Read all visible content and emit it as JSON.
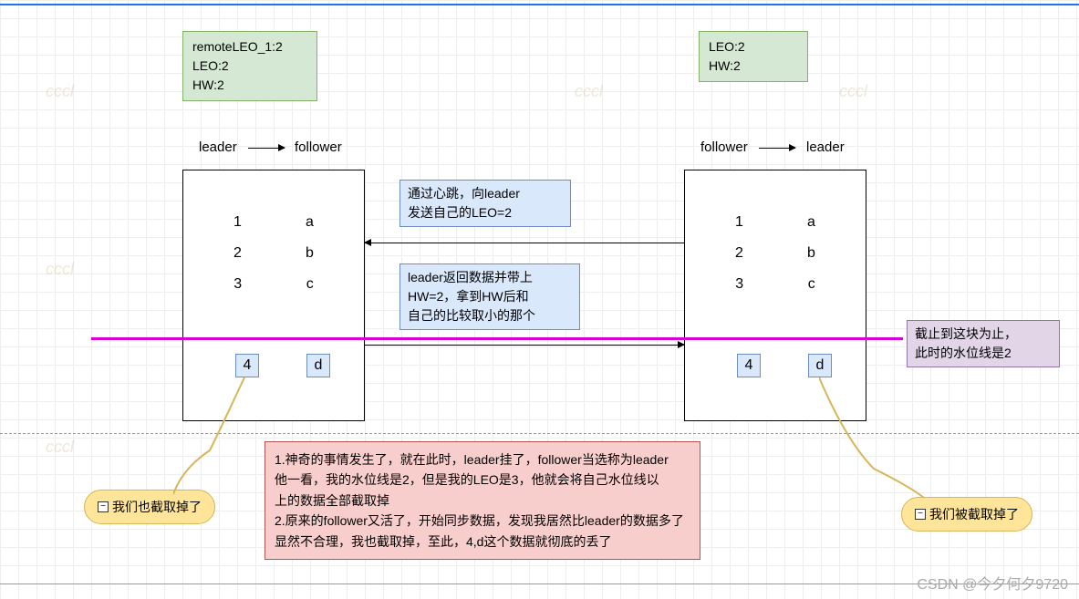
{
  "leader_info": {
    "line1": "remoteLEO_1:2",
    "line2": "LEO:2",
    "line3": "HW:2"
  },
  "follower_info": {
    "line1": "LEO:2",
    "line2": "HW:2"
  },
  "labels": {
    "leader": "leader",
    "follower": "follower"
  },
  "left_node": {
    "rows": [
      {
        "num": "1",
        "val": "a"
      },
      {
        "num": "2",
        "val": "b"
      },
      {
        "num": "3",
        "val": "c"
      }
    ],
    "extra_num": "4",
    "extra_val": "d"
  },
  "right_node": {
    "rows": [
      {
        "num": "1",
        "val": "a"
      },
      {
        "num": "2",
        "val": "b"
      },
      {
        "num": "3",
        "val": "c"
      }
    ],
    "extra_num": "4",
    "extra_val": "d"
  },
  "msg1": {
    "line1": "通过心跳，向leader",
    "line2": "发送自己的LEO=2"
  },
  "msg2": {
    "line1": "leader返回数据并带上",
    "line2": "HW=2，拿到HW后和",
    "line3": "自己的比较取小的那个"
  },
  "purple": {
    "line1": "截止到这块为止，",
    "line2": "此时的水位线是2"
  },
  "callout_left": "我们也截取掉了",
  "callout_right": "我们被截取掉了",
  "explain": {
    "line1": "1.神奇的事情发生了，就在此时，leader挂了，follower当选称为leader",
    "line2": "他一看，我的水位线是2，但是我的LEO是3，他就会将自己水位线以",
    "line3": "上的数据全部截取掉",
    "line4": "2.原来的follower又活了，开始同步数据，发现我居然比leader的数据多了",
    "line5": "显然不合理，我也截取掉，至此，4,d这个数据就彻底的丢了"
  },
  "csdn": "CSDN @今夕何夕9720"
}
